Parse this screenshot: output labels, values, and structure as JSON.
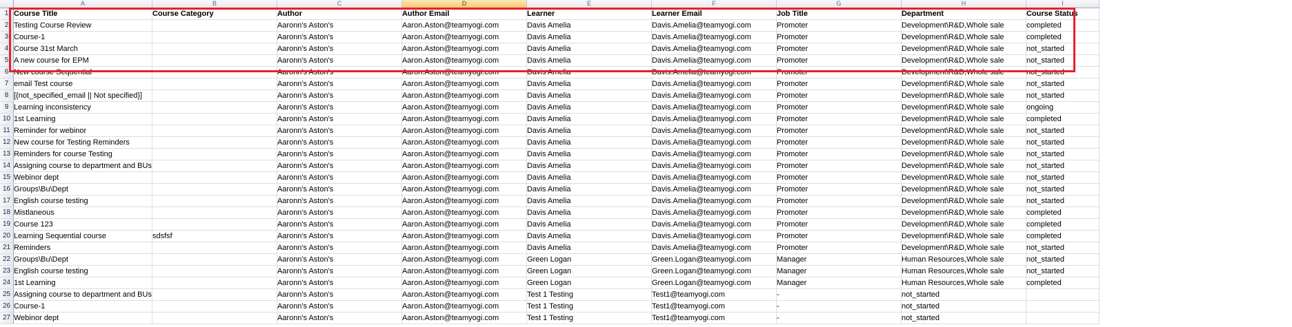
{
  "colors": {
    "selection_outline": "#e8202a",
    "selected_column_header": "#f5c870"
  },
  "column_letters": [
    "A",
    "B",
    "C",
    "D",
    "E",
    "F",
    "G",
    "H",
    "I"
  ],
  "selected_column": "D",
  "headers": [
    "Course Title",
    "Course Category",
    "Author",
    "Author Email",
    "Learner",
    "Learner Email",
    "Job Title",
    "Department",
    "Course Status"
  ],
  "rows": [
    [
      "2",
      "Testing Course Review",
      "",
      "Aaronn's Aston's",
      "Aaron.Aston@teamyogi.com",
      "Davis Amelia",
      "Davis.Amelia@teamyogi.com",
      "Promoter",
      "Development\\R&D,Whole sale",
      "completed"
    ],
    [
      "3",
      "Course-1",
      "",
      "Aaronn's Aston's",
      "Aaron.Aston@teamyogi.com",
      "Davis Amelia",
      "Davis.Amelia@teamyogi.com",
      "Promoter",
      "Development\\R&D,Whole sale",
      "completed"
    ],
    [
      "4",
      "Course 31st March",
      "",
      "Aaronn's Aston's",
      "Aaron.Aston@teamyogi.com",
      "Davis Amelia",
      "Davis.Amelia@teamyogi.com",
      "Promoter",
      "Development\\R&D,Whole sale",
      "not_started"
    ],
    [
      "5",
      "A new course for EPM",
      "",
      "Aaronn's Aston's",
      "Aaron.Aston@teamyogi.com",
      "Davis Amelia",
      "Davis.Amelia@teamyogi.com",
      "Promoter",
      "Development\\R&D,Whole sale",
      "not_started"
    ],
    [
      "6",
      "New course Sequential",
      "",
      "Aaronn's Aston's",
      "Aaron.Aston@teamyogi.com",
      "Davis Amelia",
      "Davis.Amelia@teamyogi.com",
      "Promoter",
      "Development\\R&D,Whole sale",
      "not_started"
    ],
    [
      "7",
      "email Test course",
      "",
      "Aaronn's Aston's",
      "Aaron.Aston@teamyogi.com",
      "Davis Amelia",
      "Davis.Amelia@teamyogi.com",
      "Promoter",
      "Development\\R&D,Whole sale",
      "not_started"
    ],
    [
      "8",
      "[{not_specified_email || Not specified}]",
      "",
      "Aaronn's Aston's",
      "Aaron.Aston@teamyogi.com",
      "Davis Amelia",
      "Davis.Amelia@teamyogi.com",
      "Promoter",
      "Development\\R&D,Whole sale",
      "not_started"
    ],
    [
      "9",
      "Learning inconsistency",
      "",
      "Aaronn's Aston's",
      "Aaron.Aston@teamyogi.com",
      "Davis Amelia",
      "Davis.Amelia@teamyogi.com",
      "Promoter",
      "Development\\R&D,Whole sale",
      "ongoing"
    ],
    [
      "10",
      "1st Learning",
      "",
      "Aaronn's Aston's",
      "Aaron.Aston@teamyogi.com",
      "Davis Amelia",
      "Davis.Amelia@teamyogi.com",
      "Promoter",
      "Development\\R&D,Whole sale",
      "completed"
    ],
    [
      "11",
      "Reminder for webinor",
      "",
      "Aaronn's Aston's",
      "Aaron.Aston@teamyogi.com",
      "Davis Amelia",
      "Davis.Amelia@teamyogi.com",
      "Promoter",
      "Development\\R&D,Whole sale",
      "not_started"
    ],
    [
      "12",
      "New course for Testing Reminders",
      "",
      "Aaronn's Aston's",
      "Aaron.Aston@teamyogi.com",
      "Davis Amelia",
      "Davis.Amelia@teamyogi.com",
      "Promoter",
      "Development\\R&D,Whole sale",
      "not_started"
    ],
    [
      "13",
      "Reminders for course Testing",
      "",
      "Aaronn's Aston's",
      "Aaron.Aston@teamyogi.com",
      "Davis Amelia",
      "Davis.Amelia@teamyogi.com",
      "Promoter",
      "Development\\R&D,Whole sale",
      "not_started"
    ],
    [
      "14",
      "Assigning course to department and BUs",
      "",
      "Aaronn's Aston's",
      "Aaron.Aston@teamyogi.com",
      "Davis Amelia",
      "Davis.Amelia@teamyogi.com",
      "Promoter",
      "Development\\R&D,Whole sale",
      "not_started"
    ],
    [
      "15",
      "Webinor dept",
      "",
      "Aaronn's Aston's",
      "Aaron.Aston@teamyogi.com",
      "Davis Amelia",
      "Davis.Amelia@teamyogi.com",
      "Promoter",
      "Development\\R&D,Whole sale",
      "not_started"
    ],
    [
      "16",
      "Groups\\Bu\\Dept",
      "",
      "Aaronn's Aston's",
      "Aaron.Aston@teamyogi.com",
      "Davis Amelia",
      "Davis.Amelia@teamyogi.com",
      "Promoter",
      "Development\\R&D,Whole sale",
      "not_started"
    ],
    [
      "17",
      "English course testing",
      "",
      "Aaronn's Aston's",
      "Aaron.Aston@teamyogi.com",
      "Davis Amelia",
      "Davis.Amelia@teamyogi.com",
      "Promoter",
      "Development\\R&D,Whole sale",
      "not_started"
    ],
    [
      "18",
      "Mistlaneous",
      "",
      "Aaronn's Aston's",
      "Aaron.Aston@teamyogi.com",
      "Davis Amelia",
      "Davis.Amelia@teamyogi.com",
      "Promoter",
      "Development\\R&D,Whole sale",
      "completed"
    ],
    [
      "19",
      "Course 123",
      "",
      "Aaronn's Aston's",
      "Aaron.Aston@teamyogi.com",
      "Davis Amelia",
      "Davis.Amelia@teamyogi.com",
      "Promoter",
      "Development\\R&D,Whole sale",
      "completed"
    ],
    [
      "20",
      "Learning Sequential course",
      "sdsfsf",
      "Aaronn's Aston's",
      "Aaron.Aston@teamyogi.com",
      "Davis Amelia",
      "Davis.Amelia@teamyogi.com",
      "Promoter",
      "Development\\R&D,Whole sale",
      "completed"
    ],
    [
      "21",
      "Reminders",
      "",
      "Aaronn's Aston's",
      "Aaron.Aston@teamyogi.com",
      "Davis Amelia",
      "Davis.Amelia@teamyogi.com",
      "Promoter",
      "Development\\R&D,Whole sale",
      "not_started"
    ],
    [
      "22",
      "Groups\\Bu\\Dept",
      "",
      "Aaronn's Aston's",
      "Aaron.Aston@teamyogi.com",
      "Green Logan",
      "Green.Logan@teamyogi.com",
      "Manager",
      "Human Resources,Whole sale",
      "not_started"
    ],
    [
      "23",
      "English course testing",
      "",
      "Aaronn's Aston's",
      "Aaron.Aston@teamyogi.com",
      "Green Logan",
      "Green.Logan@teamyogi.com",
      "Manager",
      "Human Resources,Whole sale",
      "not_started"
    ],
    [
      "24",
      "1st Learning",
      "",
      "Aaronn's Aston's",
      "Aaron.Aston@teamyogi.com",
      "Green Logan",
      "Green.Logan@teamyogi.com",
      "Manager",
      "Human Resources,Whole sale",
      "completed"
    ],
    [
      "25",
      "Assigning course to department and BUs",
      "",
      "Aaronn's Aston's",
      "Aaron.Aston@teamyogi.com",
      "Test 1 Testing",
      "Test1@teamyogi.com",
      "-",
      "not_started",
      ""
    ],
    [
      "26",
      "Course-1",
      "",
      "Aaronn's Aston's",
      "Aaron.Aston@teamyogi.com",
      "Test 1 Testing",
      "Test1@teamyogi.com",
      "-",
      "not_started",
      ""
    ],
    [
      "27",
      "Webinor dept",
      "",
      "Aaronn's Aston's",
      "Aaron.Aston@teamyogi.com",
      "Test 1 Testing",
      "Test1@teamyogi.com",
      "-",
      "not_started",
      ""
    ]
  ]
}
